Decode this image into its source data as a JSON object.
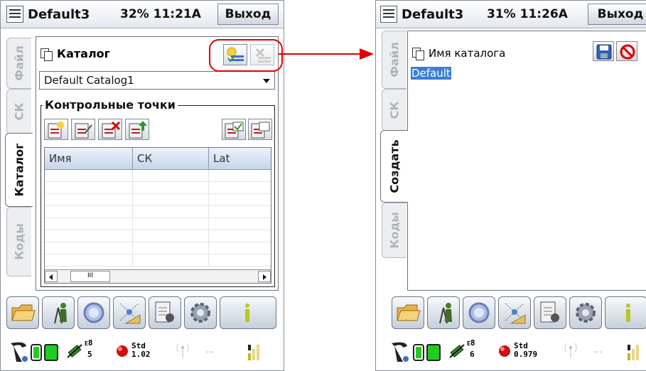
{
  "screen1": {
    "title": "Default3",
    "status": "32% 11:21A",
    "exit_label": "Выход",
    "tabs": [
      {
        "label": "Файл"
      },
      {
        "label": "СК"
      },
      {
        "label": "Каталог"
      },
      {
        "label": "Коды"
      }
    ],
    "active_tab": "Каталог",
    "catalog_label": "Каталог",
    "catalog_select": "Default Catalog1",
    "group_label": "Контрольные точки",
    "columns": [
      "Имя",
      "СК",
      "Lat"
    ],
    "scroll_thumb": "III",
    "sat": {
      "e": "E",
      "top": "8",
      "bottom": "5"
    },
    "std": {
      "label": "Std",
      "value": "1.02"
    }
  },
  "screen2": {
    "title": "Default3",
    "status": "31% 11:26A",
    "exit_label": "Выход",
    "tabs": [
      {
        "label": "Файл"
      },
      {
        "label": "СК"
      },
      {
        "label": "Создать"
      },
      {
        "label": "Коды"
      }
    ],
    "active_tab": "Создать",
    "name_label": "Имя каталога",
    "name_value": "Default",
    "sat": {
      "e": "E",
      "top": "8",
      "bottom": "6"
    },
    "std": {
      "label": "Std",
      "value": "0.979"
    }
  },
  "colors": {
    "callout": "#e00000",
    "selection": "#3a7fd4",
    "battery": "#22cc22"
  }
}
